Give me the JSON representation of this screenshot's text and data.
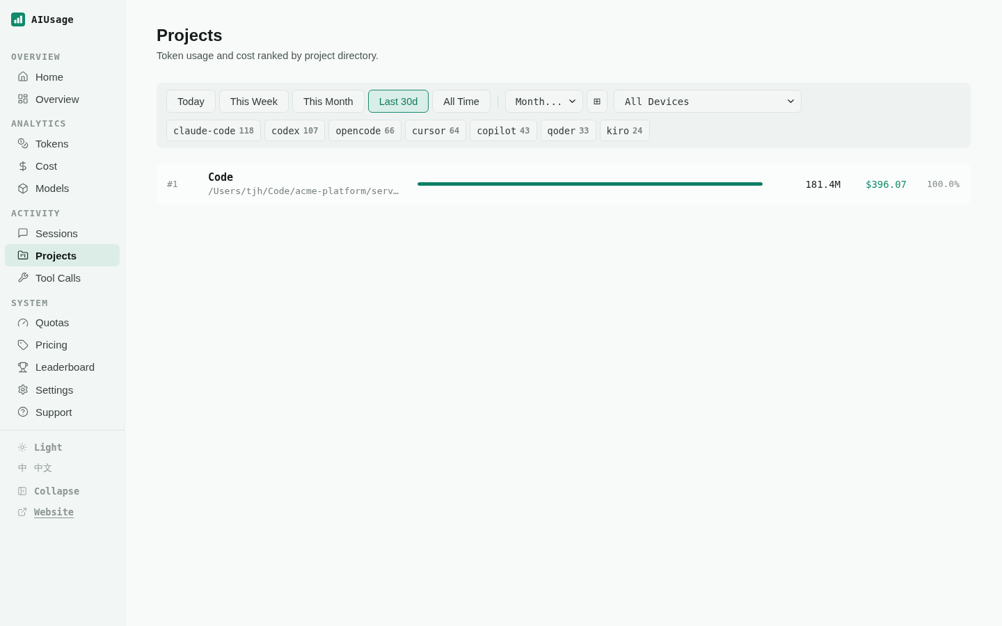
{
  "sidebar": {
    "app_name": "AIUsage",
    "sections": [
      {
        "title": "OVERVIEW",
        "items": [
          {
            "label": "Home",
            "selected": false
          },
          {
            "label": "Overview",
            "selected": false
          }
        ]
      },
      {
        "title": "ANALYTICS",
        "items": [
          {
            "label": "Tokens",
            "selected": false
          },
          {
            "label": "Cost",
            "selected": false
          },
          {
            "label": "Models",
            "selected": false
          }
        ]
      },
      {
        "title": "ACTIVITY",
        "items": [
          {
            "label": "Sessions",
            "selected": false
          },
          {
            "label": "Projects",
            "selected": true
          },
          {
            "label": "Tool Calls",
            "selected": false
          }
        ]
      },
      {
        "title": "SYSTEM",
        "items": [
          {
            "label": "Quotas",
            "selected": false
          },
          {
            "label": "Pricing",
            "selected": false
          },
          {
            "label": "Leaderboard",
            "selected": false
          },
          {
            "label": "Settings",
            "selected": false
          },
          {
            "label": "Support",
            "selected": false
          }
        ]
      }
    ],
    "footer": [
      {
        "kind": "theme",
        "label": "Light"
      },
      {
        "kind": "language",
        "glyph": "中",
        "label": "中文"
      },
      {
        "kind": "collapse",
        "label": "Collapse"
      },
      {
        "kind": "link",
        "label": "Website"
      }
    ]
  },
  "page": {
    "title": "Projects",
    "subtitle": "Token usage and cost ranked by project directory."
  },
  "filters": {
    "periods": [
      {
        "label": "Today",
        "selected": false
      },
      {
        "label": "This Week",
        "selected": false
      },
      {
        "label": "This Month",
        "selected": false
      },
      {
        "label": "Last 30d",
        "selected": true
      },
      {
        "label": "All Time",
        "selected": false
      }
    ],
    "group_by": {
      "value": "Month..."
    },
    "layout_toggle": "⊞",
    "device": {
      "value": "All Devices"
    },
    "sources": [
      {
        "name": "claude-code",
        "count": "118"
      },
      {
        "name": "codex",
        "count": "107"
      },
      {
        "name": "opencode",
        "count": "66"
      },
      {
        "name": "cursor",
        "count": "64"
      },
      {
        "name": "copilot",
        "count": "43"
      },
      {
        "name": "qoder",
        "count": "33"
      },
      {
        "name": "kiro",
        "count": "24"
      }
    ]
  },
  "projects": [
    {
      "rank": "#1",
      "name": "Code",
      "path": "/Users/tjh/Code/acme-platform/serv…",
      "level": 1,
      "tokens": "181.4M",
      "cost": "$396.07",
      "share": "100.0%"
    }
  ]
}
